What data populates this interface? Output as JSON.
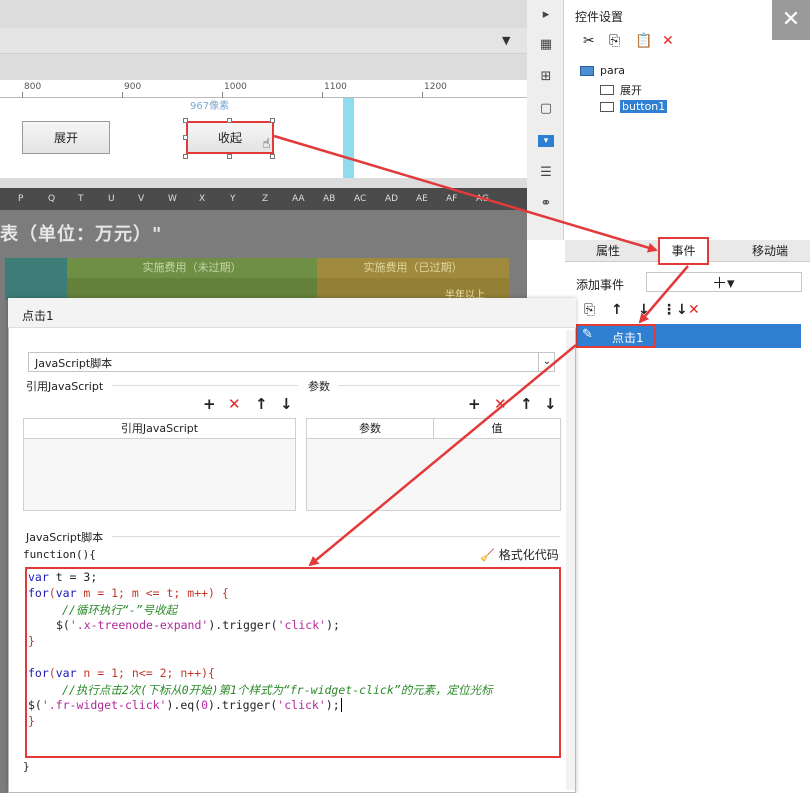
{
  "ruler": {
    "ticks": [
      "800",
      "900",
      "1000",
      "1100",
      "1200"
    ]
  },
  "canvas": {
    "pixel_note": "967像素",
    "expand_button": "展开",
    "collapse_button": "收起"
  },
  "grid": {
    "columns": [
      "P",
      "Q",
      "T",
      "U",
      "V",
      "W",
      "X",
      "Y",
      "Z",
      "AA",
      "AB",
      "AC",
      "AD",
      "AE",
      "AF",
      "AG"
    ]
  },
  "sheet": {
    "title": "表（单位：万元）\"",
    "band_green": "实施费用（未过期）",
    "band_gold": "实施费用（已过期）",
    "band_gold_sub": "半年以上"
  },
  "right_panel": {
    "title": "控件设置",
    "tree": {
      "root": "para",
      "items": [
        "展开",
        "button1"
      ]
    },
    "tabs": [
      "属性",
      "事件",
      "移动端"
    ],
    "add_event_label": "添加事件",
    "event_item": "点击1"
  },
  "dialog": {
    "title": "点击1",
    "script_type": "JavaScript脚本",
    "ref_js_label": "引用JavaScript",
    "params_label": "参数",
    "ref_js_header": "引用JavaScript",
    "param_header": "参数",
    "value_header": "值",
    "script_section": "JavaScript脚本",
    "func_open": "function(){",
    "format_code": "格式化代码",
    "func_close": "}",
    "code": {
      "l1_kw": "var",
      "l1_rest": " t = 3;",
      "l2_for": "for",
      "l2_a": "(",
      "l2_var": "var",
      "l2_b": " m = 1; m <= t; m++) {",
      "l3": "//循环执行“-”号收起",
      "l4_a": "$(",
      "l4_str": "'.x-treenode-expand'",
      "l4_b": ").trigger(",
      "l4_str2": "'click'",
      "l4_c": ");",
      "l5": "}",
      "l7_for": "for",
      "l7_a": "(",
      "l7_var": "var",
      "l7_b": " n = 1; n<= 2; n++){",
      "l8": "//执行点击2次(下标从0开始)第1个样式为“fr-widget-click”的元素，定位光标",
      "l9_a": "$(",
      "l9_str": "'.fr-widget-click'",
      "l9_b": ").eq(",
      "l9_num": "0",
      "l9_c": ").trigger(",
      "l9_str2": "'click'",
      "l9_d": ");",
      "l10": "}"
    }
  }
}
